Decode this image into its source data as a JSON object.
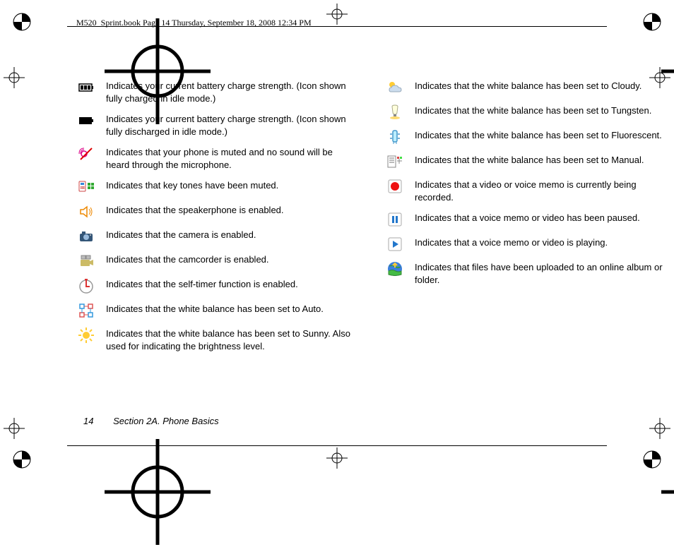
{
  "header": "M520_Sprint.book  Page 14  Thursday, September 18, 2008  12:34 PM",
  "footer": {
    "page": "14",
    "section": "Section 2A. Phone Basics"
  },
  "left": [
    {
      "icon": "battery-full-icon",
      "text": "Indicates your current battery charge strength. (Icon shown fully charged in idle mode.)"
    },
    {
      "icon": "battery-empty-icon",
      "text": "Indicates your current battery charge strength. (Icon shown fully discharged in idle mode.)"
    },
    {
      "icon": "mute-icon",
      "text": "Indicates that your phone is muted and no sound will be heard through the microphone."
    },
    {
      "icon": "keytone-mute-icon",
      "text": "Indicates that key tones have been muted."
    },
    {
      "icon": "speakerphone-icon",
      "text": "Indicates that the speakerphone is enabled."
    },
    {
      "icon": "camera-icon",
      "text": "Indicates that the camera is enabled."
    },
    {
      "icon": "camcorder-icon",
      "text": "Indicates that the camcorder is enabled."
    },
    {
      "icon": "self-timer-icon",
      "text": "Indicates that the self-timer function is enabled."
    },
    {
      "icon": "wb-auto-icon",
      "text": "Indicates that the white balance has been set to Auto."
    },
    {
      "icon": "wb-sunny-icon",
      "text": "Indicates that the white balance has been set to Sunny. Also used for indicating the brightness level."
    }
  ],
  "right": [
    {
      "icon": "wb-cloudy-icon",
      "text": "Indicates that the white balance has been set to Cloudy."
    },
    {
      "icon": "wb-tungsten-icon",
      "text": "Indicates that the white balance has been set to Tungsten."
    },
    {
      "icon": "wb-fluorescent-icon",
      "text": "Indicates that the white balance has been set to Fluorescent."
    },
    {
      "icon": "wb-manual-icon",
      "text": "Indicates that the white balance has been set to Manual."
    },
    {
      "icon": "record-icon",
      "text": "Indicates that a video or voice memo is currently being recorded."
    },
    {
      "icon": "pause-icon",
      "text": "Indicates that a voice memo or video has been paused."
    },
    {
      "icon": "play-icon",
      "text": "Indicates that a voice memo or video is playing."
    },
    {
      "icon": "upload-icon",
      "text": "Indicates that files have been uploaded to an online album or folder."
    }
  ]
}
